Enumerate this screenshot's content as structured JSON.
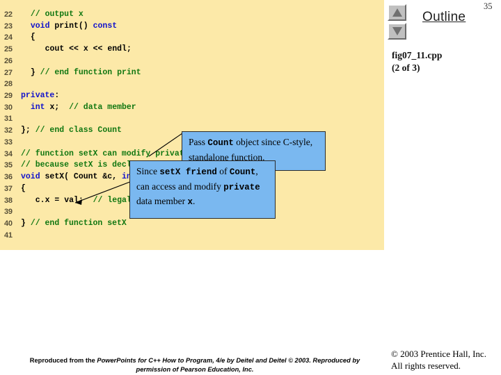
{
  "code_panel": {
    "lines": [
      {
        "n": "22",
        "indent": 2,
        "segments": [
          {
            "t": "// output x",
            "c": "cmt"
          }
        ]
      },
      {
        "n": "23",
        "indent": 2,
        "segments": [
          {
            "t": "void",
            "c": "kw"
          },
          {
            "t": " ",
            "c": "plain"
          },
          {
            "t": "print",
            "c": "plain"
          },
          {
            "t": "() ",
            "c": "plain"
          },
          {
            "t": "const",
            "c": "kw"
          }
        ]
      },
      {
        "n": "24",
        "indent": 2,
        "segments": [
          {
            "t": "{",
            "c": "plain"
          }
        ]
      },
      {
        "n": "25",
        "indent": 5,
        "segments": [
          {
            "t": "cout << x << endl;",
            "c": "plain"
          }
        ]
      },
      {
        "n": "26",
        "indent": 0,
        "segments": []
      },
      {
        "n": "27",
        "indent": 2,
        "segments": [
          {
            "t": "} ",
            "c": "plain"
          },
          {
            "t": "// end function print",
            "c": "cmt"
          }
        ]
      },
      {
        "n": "28",
        "indent": 0,
        "segments": []
      },
      {
        "n": "29",
        "indent": 0,
        "segments": [
          {
            "t": "private",
            "c": "kw"
          },
          {
            "t": ":",
            "c": "plain"
          }
        ]
      },
      {
        "n": "30",
        "indent": 2,
        "segments": [
          {
            "t": "int",
            "c": "kw"
          },
          {
            "t": " x;  ",
            "c": "plain"
          },
          {
            "t": "// data member",
            "c": "cmt"
          }
        ]
      },
      {
        "n": "31",
        "indent": 0,
        "segments": []
      },
      {
        "n": "32",
        "indent": 0,
        "segments": [
          {
            "t": "}; ",
            "c": "plain"
          },
          {
            "t": "// end class Count",
            "c": "cmt"
          }
        ]
      },
      {
        "n": "33",
        "indent": 0,
        "segments": []
      },
      {
        "n": "34",
        "indent": 0,
        "segments": [
          {
            "t": "// function setX can modify private data of Count",
            "c": "cmt"
          }
        ]
      },
      {
        "n": "35",
        "indent": 0,
        "segments": [
          {
            "t": "// because setX is declared a friend of Count",
            "c": "cmt"
          }
        ]
      },
      {
        "n": "36",
        "indent": 0,
        "segments": [
          {
            "t": "void",
            "c": "kw"
          },
          {
            "t": " setX( Count &c, ",
            "c": "plain"
          },
          {
            "t": "int",
            "c": "kw"
          },
          {
            "t": " val )",
            "c": "plain"
          }
        ]
      },
      {
        "n": "37",
        "indent": 0,
        "segments": [
          {
            "t": "{",
            "c": "plain"
          }
        ]
      },
      {
        "n": "38",
        "indent": 3,
        "segments": [
          {
            "t": "c.x = val;  ",
            "c": "plain"
          },
          {
            "t": "// legal: setX is a friend of Count",
            "c": "cmt"
          }
        ]
      },
      {
        "n": "39",
        "indent": 0,
        "segments": []
      },
      {
        "n": "40",
        "indent": 0,
        "segments": [
          {
            "t": "} ",
            "c": "plain"
          },
          {
            "t": "// end function setX",
            "c": "cmt"
          }
        ]
      },
      {
        "n": "41",
        "indent": 0,
        "segments": []
      }
    ]
  },
  "callouts": {
    "pass": {
      "part1": "Pass ",
      "code1": "Count",
      "part2": " object since C-style, standalone function."
    },
    "friend": {
      "part1": "Since ",
      "code1": "setX friend",
      "part2": " of ",
      "code2": "Count",
      "part3": ", can access and modify ",
      "code3": "private",
      "part4": " data member ",
      "code4": "x",
      "part5": "."
    }
  },
  "sidebar": {
    "title": "Outline",
    "slide_number": "35",
    "file_name": "fig07_11.cpp",
    "file_part": "(2 of 3)",
    "nav_up_icon": "triangle-up-icon",
    "nav_down_icon": "triangle-down-icon"
  },
  "footer": {
    "attribution_pre": "Reproduced from the ",
    "attribution_italic": "PowerPoints for C++ How to Program, 4/e by Deitel and Deitel © 2003. Reproduced by permission of Pearson Education, Inc.",
    "copyright_line1": "© 2003 Prentice Hall, Inc.",
    "copyright_line2": "All rights reserved."
  },
  "colors": {
    "code_background": "#fce9a8",
    "callout_fill": "#7ab8f0",
    "keyword": "#1111cc",
    "comment": "#117711",
    "line_number": "#585038"
  }
}
